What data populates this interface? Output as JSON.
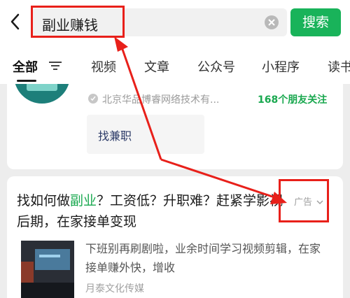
{
  "search": {
    "query": "副业赚钱",
    "button_label": "搜索"
  },
  "tabs": [
    {
      "label": "全部"
    },
    {
      "label": "视频"
    },
    {
      "label": "文章"
    },
    {
      "label": "公众号"
    },
    {
      "label": "小程序"
    },
    {
      "label": "读书"
    }
  ],
  "account_card": {
    "org_name": "北京华品博睿网络技术有...",
    "friends_follow": "168个朋友关注",
    "service_label": "找兼职"
  },
  "ad_card": {
    "title_before": "找如何做",
    "title_highlight": "副业",
    "title_after": "？工资低？升职难？赶紧学影视后期，在家接单变现",
    "ad_tag": "广告",
    "description": "下班别再刷剧啦，业余时间学习视频剪辑，在家接单赚外快，增收",
    "source": "月泰文化传媒"
  },
  "colors": {
    "accent_green": "#19b35a",
    "annotation_red": "#e8201a"
  }
}
